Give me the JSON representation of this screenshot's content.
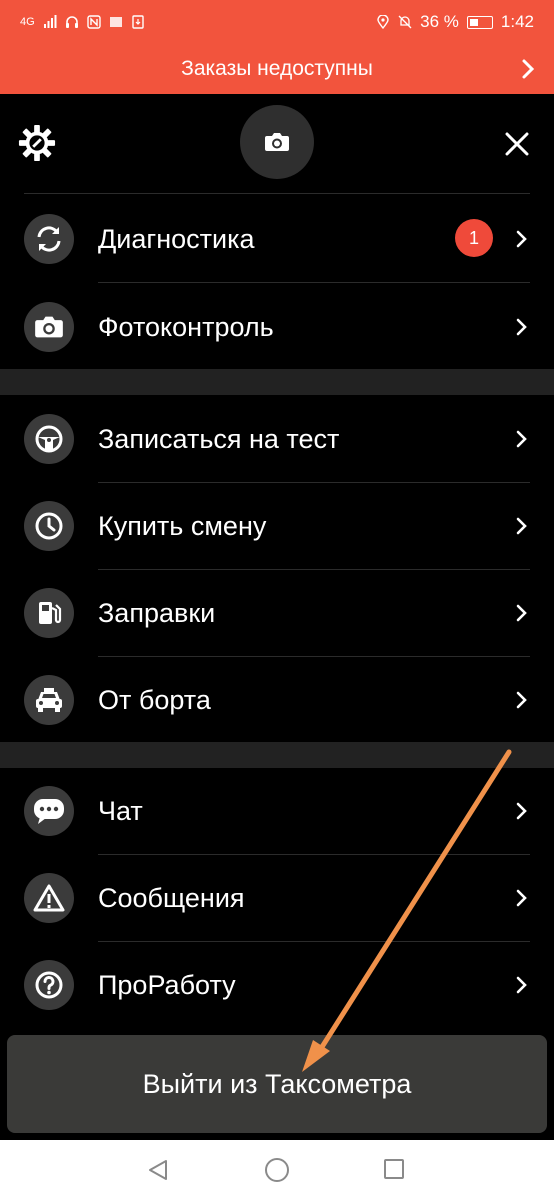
{
  "status_bar": {
    "network_label": "4G",
    "battery_percent": "36 %",
    "time": "1:42"
  },
  "banner": {
    "text": "Заказы недоступны"
  },
  "menu": {
    "section1": [
      {
        "label": "Диагностика",
        "icon": "refresh-icon",
        "badge": "1"
      },
      {
        "label": "Фотоконтроль",
        "icon": "camera-icon"
      }
    ],
    "section2": [
      {
        "label": "Записаться на тест",
        "icon": "steering-wheel-icon"
      },
      {
        "label": "Купить смену",
        "icon": "clock-icon"
      },
      {
        "label": "Заправки",
        "icon": "fuel-icon"
      },
      {
        "label": "От борта",
        "icon": "taxi-icon"
      }
    ],
    "section3": [
      {
        "label": "Чат",
        "icon": "chat-icon"
      },
      {
        "label": "Сообщения",
        "icon": "warning-icon"
      },
      {
        "label": "ПроРаботу",
        "icon": "question-icon"
      }
    ]
  },
  "exit_button": {
    "label": "Выйти из Таксометра"
  },
  "colors": {
    "accent": "#f2543d",
    "annotation_arrow": "#f0914a"
  }
}
